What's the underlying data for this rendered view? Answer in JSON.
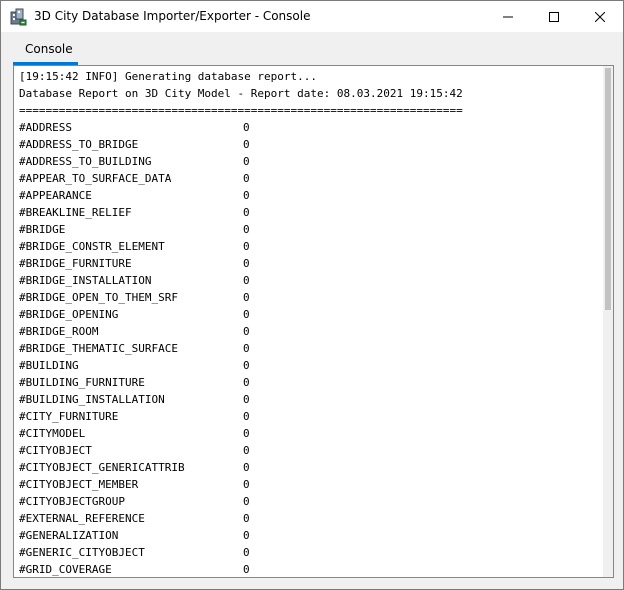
{
  "window": {
    "title": "3D City Database Importer/Exporter - Console",
    "icon": "3dcitydb-app-icon"
  },
  "tabs": [
    {
      "label": "Console",
      "active": true
    }
  ],
  "console": {
    "header_lines": [
      "[19:15:42 INFO] Generating database report...",
      "Database Report on 3D City Model - Report date: 08.03.2021 19:15:42",
      "==================================================================="
    ],
    "rows": [
      {
        "key": "#ADDRESS",
        "value": "0"
      },
      {
        "key": "#ADDRESS_TO_BRIDGE",
        "value": "0"
      },
      {
        "key": "#ADDRESS_TO_BUILDING",
        "value": "0"
      },
      {
        "key": "#APPEAR_TO_SURFACE_DATA",
        "value": "0"
      },
      {
        "key": "#APPEARANCE",
        "value": "0"
      },
      {
        "key": "#BREAKLINE_RELIEF",
        "value": "0"
      },
      {
        "key": "#BRIDGE",
        "value": "0"
      },
      {
        "key": "#BRIDGE_CONSTR_ELEMENT",
        "value": "0"
      },
      {
        "key": "#BRIDGE_FURNITURE",
        "value": "0"
      },
      {
        "key": "#BRIDGE_INSTALLATION",
        "value": "0"
      },
      {
        "key": "#BRIDGE_OPEN_TO_THEM_SRF",
        "value": "0"
      },
      {
        "key": "#BRIDGE_OPENING",
        "value": "0"
      },
      {
        "key": "#BRIDGE_ROOM",
        "value": "0"
      },
      {
        "key": "#BRIDGE_THEMATIC_SURFACE",
        "value": "0"
      },
      {
        "key": "#BUILDING",
        "value": "0"
      },
      {
        "key": "#BUILDING_FURNITURE",
        "value": "0"
      },
      {
        "key": "#BUILDING_INSTALLATION",
        "value": "0"
      },
      {
        "key": "#CITY_FURNITURE",
        "value": "0"
      },
      {
        "key": "#CITYMODEL",
        "value": "0"
      },
      {
        "key": "#CITYOBJECT",
        "value": "0"
      },
      {
        "key": "#CITYOBJECT_GENERICATTRIB",
        "value": "0"
      },
      {
        "key": "#CITYOBJECT_MEMBER",
        "value": "0"
      },
      {
        "key": "#CITYOBJECTGROUP",
        "value": "0"
      },
      {
        "key": "#EXTERNAL_REFERENCE",
        "value": "0"
      },
      {
        "key": "#GENERALIZATION",
        "value": "0"
      },
      {
        "key": "#GENERIC_CITYOBJECT",
        "value": "0"
      },
      {
        "key": "#GRID_COVERAGE",
        "value": "0"
      }
    ]
  },
  "colors": {
    "accent": "#0078d7",
    "titlebar": "#ffffff",
    "window_bg": "#f0f0f0",
    "console_bg": "#ffffff"
  }
}
